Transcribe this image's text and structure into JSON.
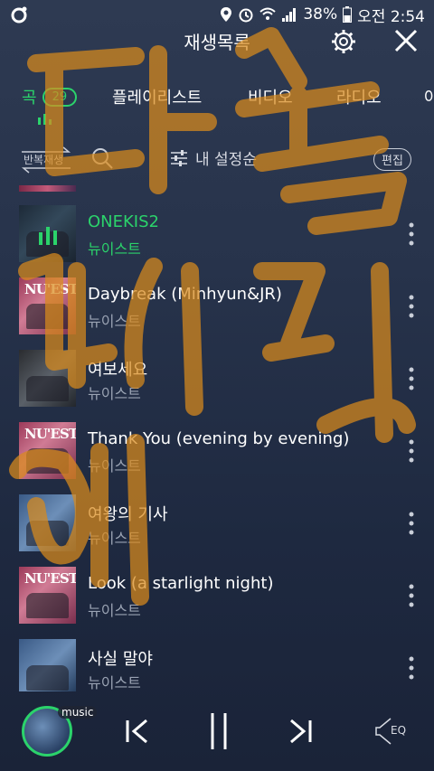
{
  "status": {
    "battery": "38%",
    "time": "오전 2:54"
  },
  "header": {
    "title": "재생목록"
  },
  "tabs": [
    {
      "label": "곡",
      "count": "29",
      "active": true
    },
    {
      "label": "플레이리스트"
    },
    {
      "label": "비디오"
    },
    {
      "label": "라디오"
    },
    {
      "label": "아"
    }
  ],
  "controls": {
    "repeat_label": "반복재생",
    "sort_label": "내 설정순",
    "edit_label": "편집"
  },
  "songs": [
    {
      "title": "ONEKIS2",
      "artist": "뉴이스트",
      "playing": true
    },
    {
      "title": "Daybreak (Minhyun&JR)",
      "artist": "뉴이스트"
    },
    {
      "title": "여보세요",
      "artist": "뉴이스트"
    },
    {
      "title": "Thank You (evening by evening)",
      "artist": "뉴이스트"
    },
    {
      "title": "여왕의 기사",
      "artist": "뉴이스트"
    },
    {
      "title": "Look (a starlight night)",
      "artist": "뉴이스트"
    },
    {
      "title": "사실 말야",
      "artist": "뉴이스트"
    }
  ],
  "album_art": {
    "text": "NU'EST"
  },
  "player": {
    "music_label": "music",
    "eq_label": "EQ"
  },
  "colors": {
    "accent": "#2bd36b",
    "overlay_marker": "#d98a1c"
  }
}
